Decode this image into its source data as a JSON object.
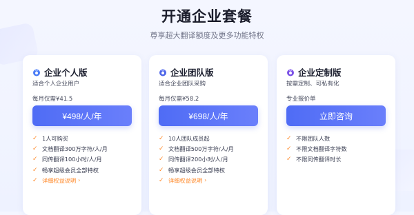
{
  "page": {
    "title": "开通企业套餐",
    "subtitle": "尊享超大翻译额度及更多功能特权"
  },
  "colors": {
    "accent": "#5570f6",
    "check": "#ff8a2b",
    "icon_personal": "#4a7cf6",
    "icon_team": "#4e66e8",
    "icon_custom": "#7b52e6"
  },
  "cards": [
    {
      "icon": "medal-icon",
      "name": "企业个人版",
      "desc": "适合个人企业用户",
      "price_note": "每月仅需¥41.5",
      "button": "¥498/人/年",
      "features": [
        "1人可购买",
        "文档翻译300万字符/人/月",
        "同传翻译100小时/人/月",
        "畅享超级会员全部特权"
      ],
      "link": "详细权益说明"
    },
    {
      "icon": "medal-icon",
      "name": "企业团队版",
      "desc": "适合企业团队采购",
      "price_note": "每月仅需¥58.2",
      "button": "¥698/人/年",
      "features": [
        "10人团队成员起",
        "文档翻译500万字符/人/月",
        "同传翻译200小时/人/月",
        "畅享超级会员全部特权"
      ],
      "link": "详细权益说明"
    },
    {
      "icon": "medal-icon",
      "name": "企业定制版",
      "desc": "按需定制、可私有化",
      "price_note": "专业报价单",
      "button": "立即咨询",
      "features": [
        "不限团队人数",
        "不限文档翻译字符数",
        "不限同传翻译时长"
      ]
    }
  ]
}
